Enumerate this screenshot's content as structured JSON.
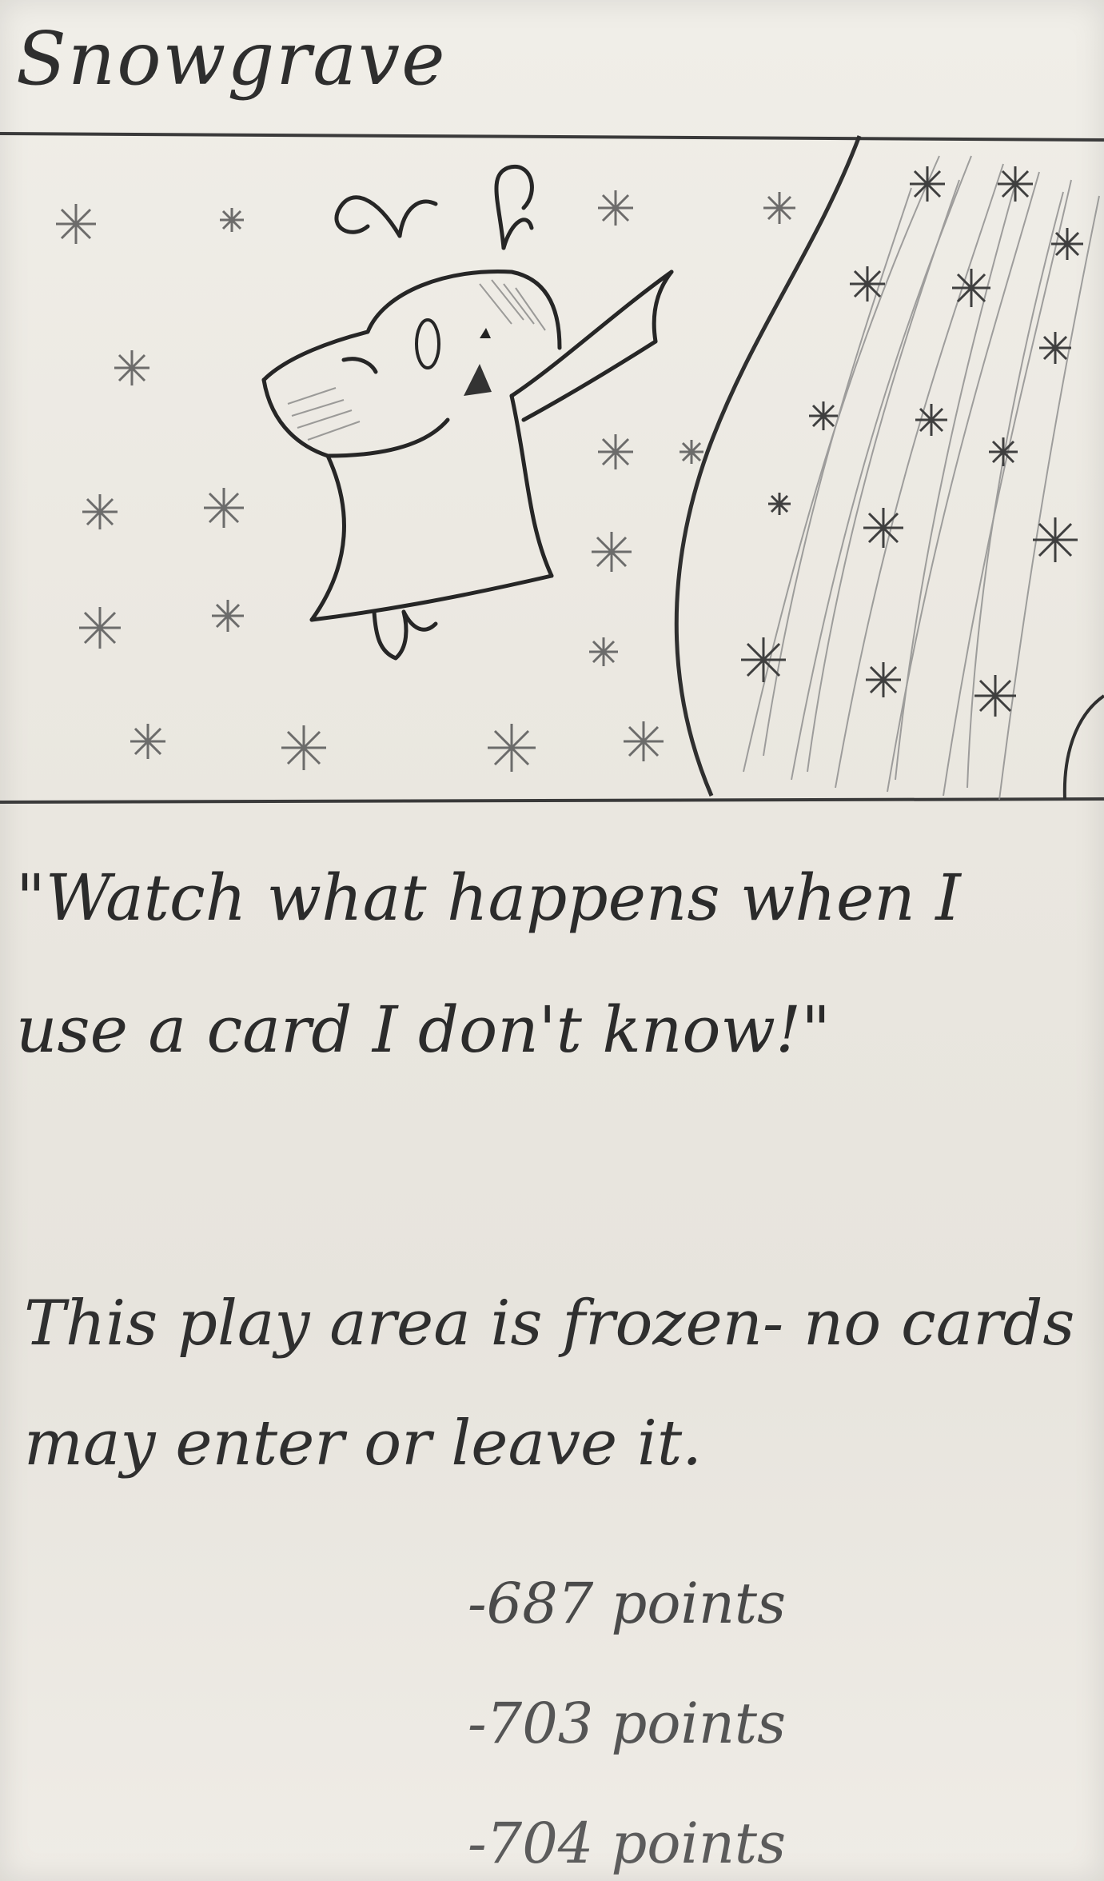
{
  "card": {
    "title": "Snowgrave",
    "quote": "\"Watch what happens when I use a card I don't know!\"",
    "rules_text": "This play area is frozen- no cards may enter or leave it.",
    "scores": [
      "-687 points",
      "-703 points",
      "-704 points"
    ]
  },
  "colors": {
    "paper": "#ece9e2",
    "pencil": "#2e2e2e"
  }
}
